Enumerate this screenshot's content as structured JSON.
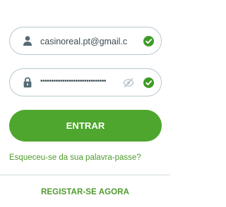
{
  "login": {
    "email": {
      "value": "casinoreal.pt@gmail.com",
      "icon": "user-icon",
      "status_icon": "check-icon"
    },
    "password": {
      "value": "••••••••••••••••••••••••••••••",
      "icon": "lock-icon",
      "toggle_icon": "eye-off-icon",
      "status_icon": "check-icon"
    },
    "submit_label": "ENTRAR",
    "forgot_label": "Esqueceu-se da sua palavra-passe?",
    "register_label": "REGISTAR-SE AGORA"
  },
  "colors": {
    "accent": "#4ea62e",
    "link": "#4e9b2c",
    "field_border": "#b7c8cf",
    "icon": "#556b75",
    "eye_icon": "#b9c7cc"
  }
}
